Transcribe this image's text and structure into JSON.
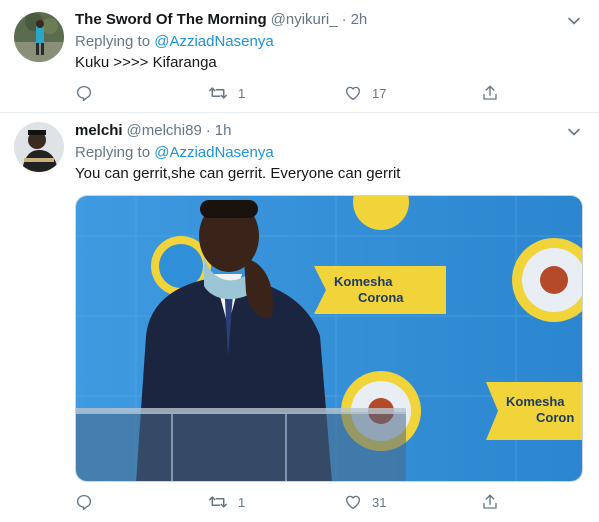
{
  "tweets": [
    {
      "name": "The Sword Of The Morning",
      "handle": "@nyikuri_",
      "separator": "·",
      "time": "2h",
      "replying_label": "Replying to",
      "replying_to": "@AzziadNasenya",
      "text": "Kuku >>>> Kifaranga",
      "retweets": "1",
      "likes": "17"
    },
    {
      "name": "melchi",
      "handle": "@melchi89",
      "separator": "·",
      "time": "1h",
      "replying_label": "Replying to",
      "replying_to": "@AzziadNasenya",
      "text": "You can gerrit,she can gerrit. Everyone can gerrit",
      "retweets": "1",
      "likes": "31",
      "image": {
        "banner_text_1": "Komesha",
        "banner_text_2": "Corona",
        "banner_text_3": "Komesha",
        "banner_text_4": "Coron"
      }
    }
  ],
  "icons": {
    "reply": "reply-icon",
    "retweet": "retweet-icon",
    "like": "heart-icon",
    "share": "share-icon",
    "caret": "chevron-down-icon"
  },
  "colors": {
    "text": "#14171a",
    "secondary": "#657786",
    "link": "#1b95e0",
    "border": "#e6ecf0",
    "backdrop_blue": "#2f8fd8",
    "banner_yellow": "#f1d33a"
  }
}
